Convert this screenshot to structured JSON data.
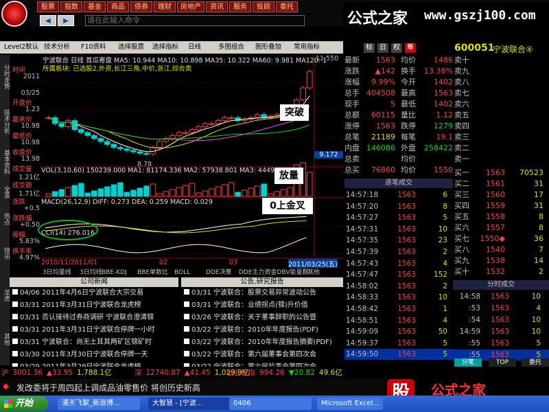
{
  "top_menu": [
    "股票",
    "指数",
    "基金",
    "商品",
    "债券",
    "理财",
    "房地产",
    "资讯",
    "服务",
    "投顾",
    "委托"
  ],
  "command_input_placeholder": "请在此输入命令",
  "brand": {
    "name": "公式之家",
    "url": "www.gszj100.com"
  },
  "toolbar": [
    "Level2默认",
    "技术分析",
    "F10资料",
    "选择股票",
    "选择指标",
    "日线",
    "多图组合",
    "图形叠加",
    "常用指标"
  ],
  "left_tabs": [
    "分时走势",
    "技术分析",
    "基本资料",
    "全景",
    "热点",
    "快讯",
    "龙虎",
    "其他"
  ],
  "left_info": [
    {
      "label": "时间",
      "value": "2011"
    },
    {
      "label": "",
      "value": "03/25"
    },
    {
      "label": "开盘价",
      "value": "1.23"
    },
    {
      "label": "最高价",
      "value": "10.98"
    },
    {
      "label": "最低价",
      "value": "10.98"
    },
    {
      "label": "收盘价",
      "value": "13.98"
    },
    {
      "label": "成交量",
      "value": "1.21亿"
    },
    {
      "label": "成交额",
      "value": "1.71亿"
    },
    {
      "label": "涨跌",
      "value": "+0.5"
    },
    {
      "label": "涨跌幅",
      "value": "+0.50"
    },
    {
      "label": "振幅",
      "value": "5.83%"
    },
    {
      "label": "换手率",
      "value": "4.97%"
    }
  ],
  "chart": {
    "title": "宁波联合 日线 首瓜寄盘 MA5: 10.944  MA10: 10.898  MA35: 10.322  MA60: 9.981  MA120: 1",
    "subtitle": "所属板块: 已选股2,外资,长江三角,中价,浙江,综合类",
    "top_price": "11.550",
    "low_marker": "8.78",
    "right_label": "9.172",
    "vol_title": "VOL(3,10,60) 150239.000  MA1: 81174.336  MA2: 57938.801  MA3: 44493.666",
    "macd_title": "MACD(26,12,9) DIFF: 0.273  DEA: 0.259  MACD: 0.029",
    "cci_title": "CCI(14) 276.016",
    "date_left": "2010/11/2011/01",
    "date_mid1": "02",
    "date_mid2": "03",
    "date_right": "2011/03/25(五)",
    "ann_break": "突破",
    "ann_volume": "放量",
    "ann_golden": "0上金叉",
    "x_dates": [
      "2010/11",
      "2011/01",
      "02",
      "03"
    ],
    "candles": [
      10.0,
      9.8,
      9.7,
      9.9,
      9.6,
      9.5,
      9.4,
      9.3,
      9.2,
      9.1,
      9.0,
      8.95,
      8.9,
      8.85,
      8.8,
      8.78,
      9.0,
      9.2,
      9.3,
      9.4,
      9.5,
      9.5,
      9.6,
      9.7,
      9.8,
      9.8,
      9.9,
      10.0,
      10.0,
      9.9,
      9.95,
      10.0,
      10.1,
      10.0,
      10.05,
      10.1,
      10.2,
      10.3,
      10.6,
      11.0,
      11.55
    ]
  },
  "bottom_tabs": [
    "3日均量线",
    "3日均线",
    "BBE-KDJ",
    "BBE单数比",
    "BOLL",
    "DDE决策",
    "DDE主力资金DBV能量群",
    "其他"
  ],
  "news_left": {
    "title": "公司新闻",
    "items": [
      "04/06 2011年4月6日宁波联合大宗交易",
      "03/31 2011年3月31日宁波联合龙虎榜",
      "03/31 否认接待过券商调研 宁波联合澄清锦",
      "03/31 2011年3月31日宁波联合停牌一小时",
      "03/31 宁波联合：尚无土耳其两矿区锦矿时",
      "03/30 2011年3月30日宁波联合停牌一天",
      "03/29 2011年3月29日宁波联合龙虎榜"
    ]
  },
  "news_right": {
    "title": "公告,研究报告",
    "items": [
      "03/31 宁波联合：股票交易异常波动公告",
      "03/31 宁波联合：业绩拐点(锦)升价值",
      "03/26 宁波联合：关于董事辞职的公告暨",
      "03/22 宁波联合：2010年年度报告(PDF)",
      "03/22 宁波联合：2010年年度报告摘要(PDF)",
      "03/22 宁波联合：第六届董事会第四次会",
      "03/22 宁波联合：第六届监事会第四次会"
    ]
  },
  "right_header": {
    "tabs": [
      "标",
      "日",
      "权",
      "筹"
    ],
    "code": "600051",
    "name": "宁波联合④"
  },
  "quote": [
    {
      "l1": "最新",
      "v1": "1563",
      "l2": "均价",
      "v2": "1486"
    },
    {
      "l1": "涨跌",
      "v1": "▲142",
      "l2": "换手",
      "v2": "13.38%"
    },
    {
      "l1": "涨幅",
      "v1": "9.99%",
      "l2": "今开",
      "v2": "1402"
    },
    {
      "l1": "总手",
      "v1": "404508",
      "l2": "最高",
      "v2": "1563"
    },
    {
      "l1": "现手",
      "v1": "5",
      "l2": "最低",
      "v2": "1402"
    },
    {
      "l1": "总额",
      "v1": "60115",
      "l2": "量比",
      "v2": "1.12"
    },
    {
      "l1": "涨停",
      "v1": "1563",
      "l2": "跌停",
      "v2": "1279"
    },
    {
      "l1": "总笔",
      "v1": "21189",
      "l2": "每笔",
      "v2": "19.1"
    },
    {
      "l1": "内盘",
      "v1": "146086",
      "l2": "外盘",
      "v2": "258422"
    },
    {
      "l1": "总卖",
      "v1": "",
      "l2": "均价",
      "v2": ""
    },
    {
      "l1": "总买",
      "v1": "76860",
      "l2": "均价",
      "v2": "1550"
    }
  ],
  "sell_orders": [
    {
      "label": "卖十",
      "price": "",
      "vol": ""
    },
    {
      "label": "卖九",
      "price": "",
      "vol": ""
    },
    {
      "label": "卖八",
      "price": "",
      "vol": ""
    },
    {
      "label": "卖七",
      "price": "",
      "vol": ""
    },
    {
      "label": "卖六",
      "price": "",
      "vol": ""
    },
    {
      "label": "卖五",
      "price": "",
      "vol": ""
    },
    {
      "label": "卖四",
      "price": "",
      "vol": ""
    },
    {
      "label": "卖三",
      "price": "",
      "vol": ""
    },
    {
      "label": "卖二",
      "price": "",
      "vol": ""
    },
    {
      "label": "卖一",
      "price": "",
      "vol": ""
    }
  ],
  "buy_orders": [
    {
      "label": "买一",
      "price": "1563",
      "vol": "70523"
    },
    {
      "label": "买二",
      "price": "1561",
      "vol": "31"
    },
    {
      "label": "买三",
      "price": "1560",
      "vol": "17"
    },
    {
      "label": "买四",
      "price": "1559",
      "vol": "31"
    },
    {
      "label": "买五",
      "price": "1558",
      "vol": "8"
    },
    {
      "label": "买六",
      "price": "1557",
      "vol": "8"
    },
    {
      "label": "买七",
      "price": "1550◆",
      "vol": "36"
    },
    {
      "label": "买八",
      "price": "1540",
      "vol": "7"
    },
    {
      "label": "买九",
      "price": "1538",
      "vol": "14"
    },
    {
      "label": "买十",
      "price": "1532",
      "vol": "2"
    }
  ],
  "trades_title": "逐笔成交",
  "trades": [
    {
      "t": "14:57:18",
      "p": "1563",
      "v": "6"
    },
    {
      "t": "14:57:20",
      "p": "1563",
      "v": "8"
    },
    {
      "t": "14:57:27",
      "p": "1563",
      "v": "5"
    },
    {
      "t": "14:57:31",
      "p": "1563",
      "v": "10"
    },
    {
      "t": "14:57:35",
      "p": "1563",
      "v": "23"
    },
    {
      "t": "14:57:39",
      "p": "1563",
      "v": "2"
    },
    {
      "t": "14:57:43",
      "p": "1563",
      "v": "4"
    },
    {
      "t": "14:57:47",
      "p": "1563",
      "v": "152"
    },
    {
      "t": "14:58:02",
      "p": "1563",
      "v": "2"
    },
    {
      "t": "14:58:33",
      "p": "1563",
      "v": "10"
    },
    {
      "t": "14:58:42",
      "p": "1563",
      "v": "1"
    },
    {
      "t": "14:58:51",
      "p": "1563",
      "v": "4"
    },
    {
      "t": "14:59:09",
      "p": "1563",
      "v": "50"
    },
    {
      "t": "14:59:37",
      "p": "1563",
      "v": "5"
    },
    {
      "t": "14:59:50",
      "p": "1563",
      "v": "5"
    }
  ],
  "minute_title": "分时成交",
  "minute": [
    {
      "t": "14:58",
      "p": "1563",
      "v": "10"
    },
    {
      "t": ":53",
      "p": "1563",
      "v": "4"
    },
    {
      "t": ":54",
      "p": "1563",
      "v": "10"
    },
    {
      "t": "14:59",
      "p": "1563",
      "v": "10"
    },
    {
      "t": ":55",
      "p": "1563",
      "v": "5"
    },
    {
      "t": ":55",
      "p": "1563",
      "v": "5"
    }
  ],
  "right_bottom_tabs": [
    "分笔",
    "TOP",
    "委托"
  ],
  "status": [
    {
      "l": "沪",
      "v": "3001.36",
      "c": "▲33.95",
      "c2": "1,788.1亿"
    },
    {
      "l": "深",
      "v": "12740.87",
      "c": "▲41.45",
      "c2": "1,029.9亿"
    },
    {
      "l": "创业板指",
      "v": "994.26",
      "c": "▼20.82",
      "c2": "49.6亿"
    }
  ],
  "ticker_text": "发改委将于周四起上调成品油零售价 将创历史新高",
  "taskbar": {
    "start": "开始",
    "items": [
      "漫天飞絮_新浪博...",
      "大智慧 - [宁波...",
      "0406",
      "Microsoft Excel..."
    ]
  },
  "colors": {
    "accent_red": "#ff4040",
    "accent_green": "#00e000",
    "panel_bg": "#000000"
  }
}
